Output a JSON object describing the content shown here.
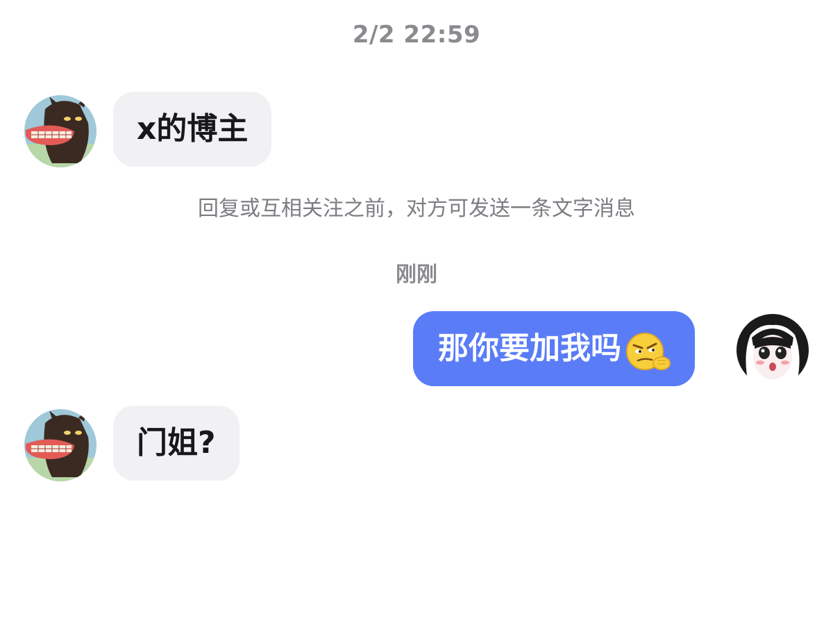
{
  "conversation": {
    "timestamp_top": "2/2 22:59",
    "system_notice": "回复或互相关注之前，对方可发送一条文字消息",
    "timestamp_recent": "刚刚",
    "messages": [
      {
        "sender": "other",
        "text": "x的博主"
      },
      {
        "sender": "self",
        "text": "那你要加我吗",
        "emoji": "smirk-thinking-emoji"
      },
      {
        "sender": "other",
        "text": "门姐?"
      }
    ]
  },
  "colors": {
    "incoming_bubble": "#f1f1f4",
    "outgoing_bubble": "#5a7cf7",
    "timestamp_text": "#8a8a8f"
  }
}
